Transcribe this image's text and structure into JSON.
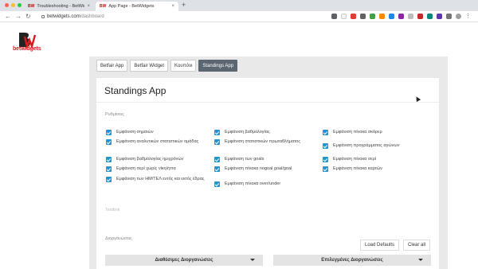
{
  "browser": {
    "tabs": [
      {
        "label": "Troubleshooting - BetWidgets",
        "favicon": "BW"
      },
      {
        "label": "App Page - BetWidgets",
        "favicon": "BW"
      }
    ],
    "url_host": "betwidgets.com",
    "url_path": "/dashboard"
  },
  "site": {
    "logo_text": "betwidgets"
  },
  "app_tabs": [
    "Betfair App",
    "Betfair Widget",
    "Κουπόνι",
    "Standings App"
  ],
  "card": {
    "title": "Standings App",
    "settings_label": "Ρυθμίσεις",
    "options_col1": [
      "Εμφάνιση σημαιών",
      "Εμφάνιση αναλυτικών στατιστικών ομάδας",
      "Εμφάνιση βαθμολογίας ημιχρόνων",
      "Εμφάνιση σερί χωρίς νίκη/ήττα",
      "Εμφάνιση των ΗΜ/ΤΕΛ εντός και εκτός έδρας"
    ],
    "options_col2": [
      "Εμφάνιση βαθμολογίας",
      "Εμφάνιση στατιστικών πρωταθλήματος",
      "Εμφάνιση των goals",
      "Εμφάνιση πίνακα nogoal goal/goal",
      "Εμφάνιση πίνακα over/under"
    ],
    "options_col3": [
      "Εμφάνιση πίνακα σκόρερ",
      "Εμφάνιση προγράμματος αγώνων",
      "Εμφάνιση πίνακα σερί",
      "Εμφάνιση πίνακα καρτών"
    ],
    "textlink_label": "Textlink",
    "competitions_label": "Διοργανώσεις",
    "load_defaults_label": "Load Defaults",
    "clear_all_label": "Clear all",
    "available_label": "Διαθέσιμες Διοργανώσεις",
    "selected_label": "Επιλεγμένες Διοργανώσεις"
  },
  "colors": {
    "accent": "#2196d3",
    "active_tab": "#5b6671",
    "brand": "#d71920"
  }
}
